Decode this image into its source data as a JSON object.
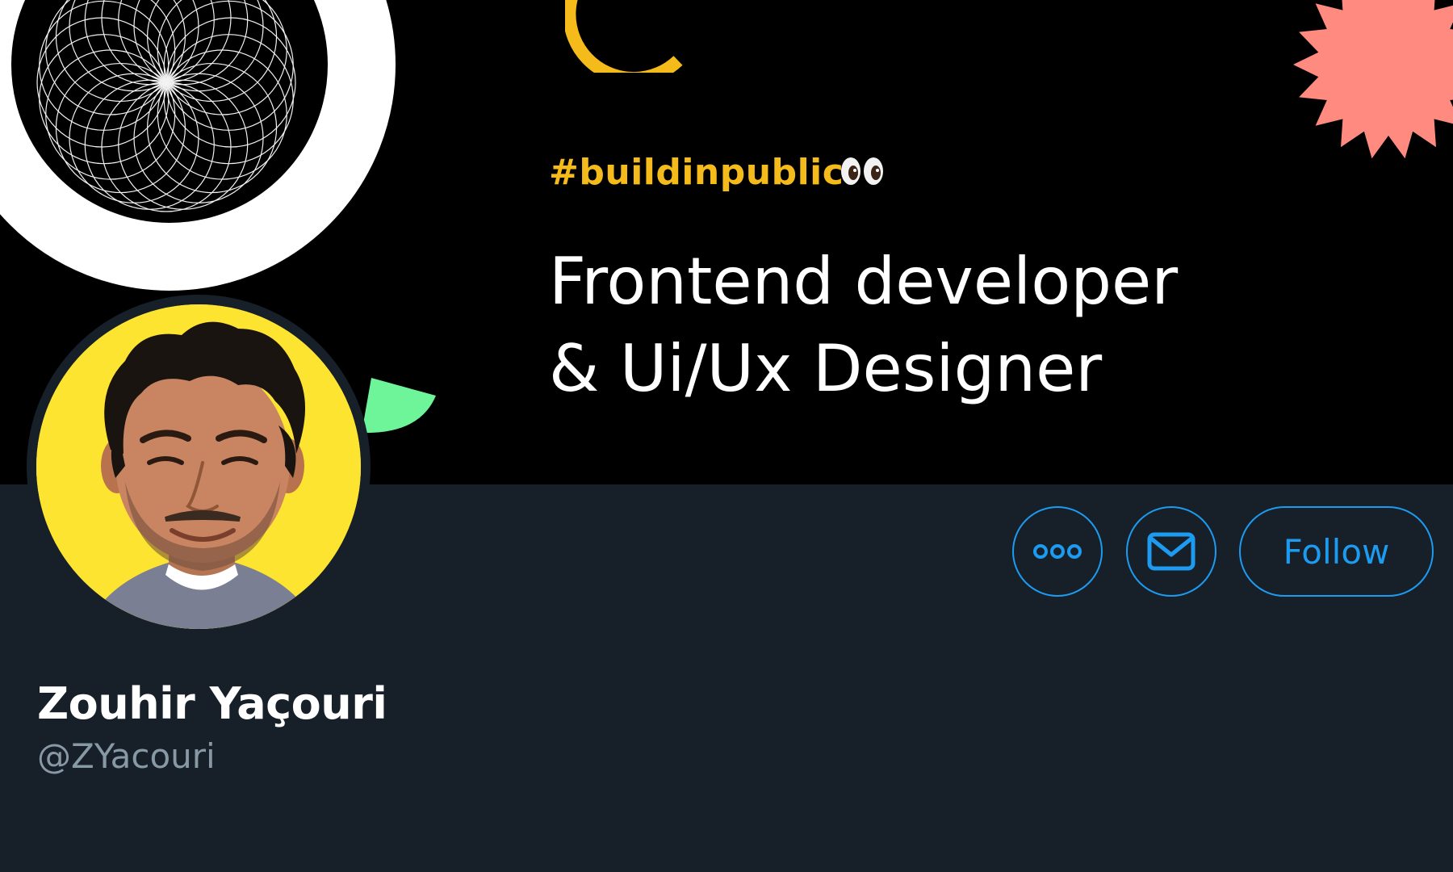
{
  "banner": {
    "hashtag": "#buildinpublic",
    "hashtag_emoji": "eyes-emoji",
    "headline_line1": "Frontend developer",
    "headline_line2": "& Ui/Ux Designer",
    "colors": {
      "background": "#000000",
      "hashtag": "#f4bb1a",
      "ring": "#ffffff",
      "arc": "#f4bb1a",
      "starburst": "#ff8a80",
      "wedge": "#6ef59a"
    }
  },
  "profile": {
    "display_name": "Zouhir Yaçouri",
    "handle": "@ZYacouri",
    "avatar": "profile-photo",
    "avatar_background": "#fde431"
  },
  "actions": {
    "more_icon": "more-horizontal-icon",
    "message_icon": "envelope-icon",
    "follow_label": "Follow",
    "accent_color": "#1d9bf0"
  },
  "colors": {
    "page_background": "#172029",
    "handle_text": "#8899a6",
    "name_text": "#ffffff"
  }
}
